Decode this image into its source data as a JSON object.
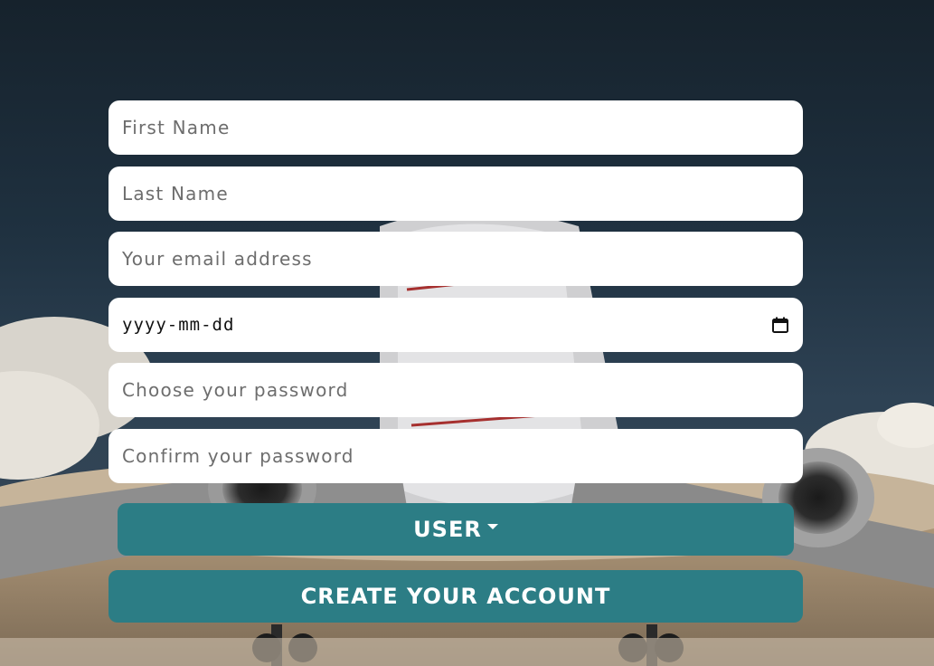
{
  "form": {
    "first_name_placeholder": "First Name",
    "last_name_placeholder": "Last Name",
    "email_placeholder": "Your email address",
    "dob_placeholder": "yyyy-mm-dd",
    "password_placeholder": "Choose your password",
    "confirm_password_placeholder": "Confirm your password"
  },
  "role_dropdown": {
    "selected": "USER",
    "icon": "caret-down-icon"
  },
  "submit_button": {
    "label": "CREATE YOUR ACCOUNT"
  },
  "icons": {
    "calendar": "calendar-icon"
  },
  "colors": {
    "button": "#2c7d85",
    "field_background": "#ffffff",
    "sky_top": "#1b2733"
  }
}
